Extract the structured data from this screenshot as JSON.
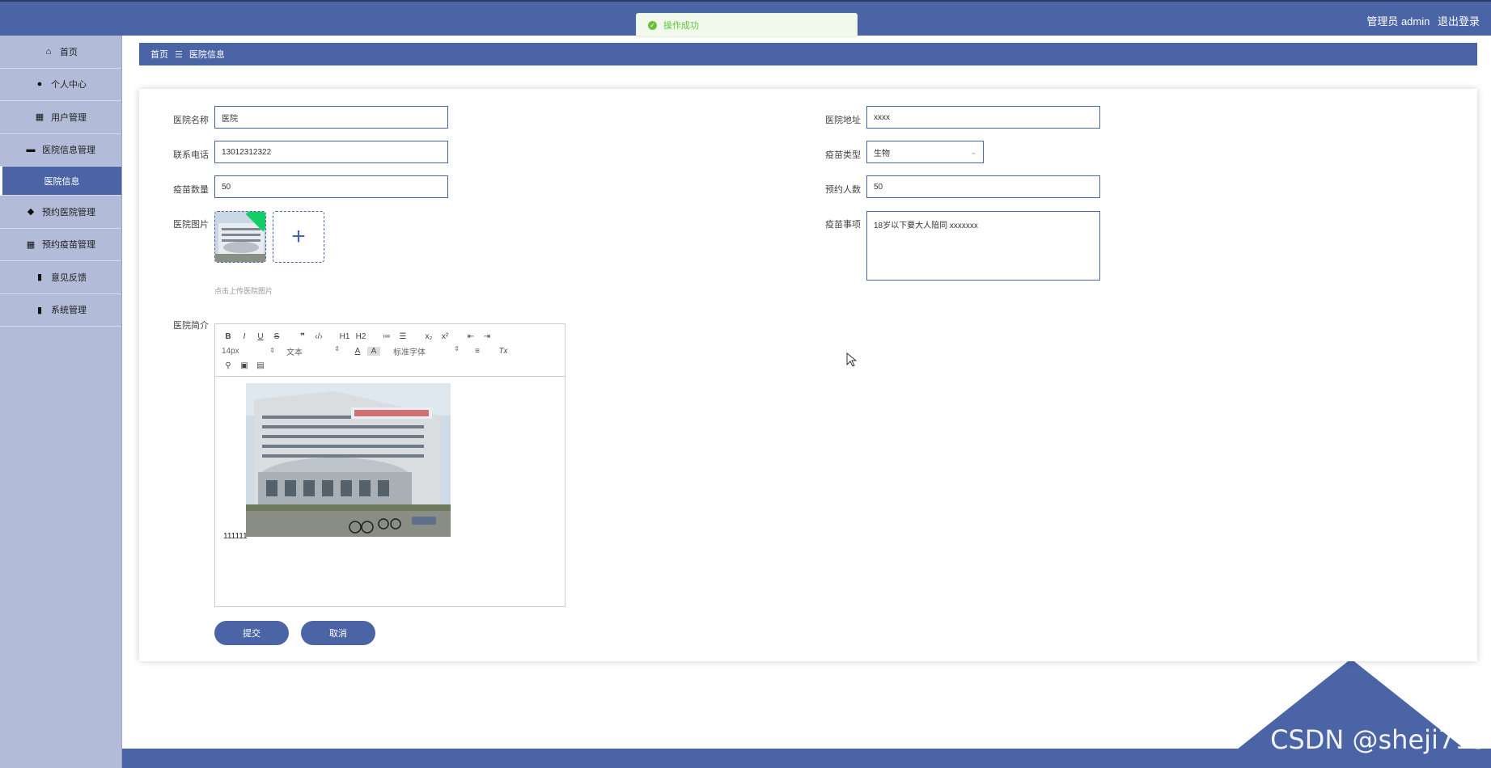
{
  "header": {
    "user_label": "管理员 admin",
    "logout_label": "退出登录"
  },
  "toast": {
    "message": "操作成功"
  },
  "sidebar": {
    "items": [
      {
        "label": "首页",
        "icon": "home-icon"
      },
      {
        "label": "个人中心",
        "icon": "user-icon"
      },
      {
        "label": "用户管理",
        "icon": "grid-icon"
      },
      {
        "label": "医院信息管理",
        "icon": "briefcase-icon"
      },
      {
        "label": "医院信息",
        "icon": "",
        "sub": true
      },
      {
        "label": "预约医院管理",
        "icon": "location-icon"
      },
      {
        "label": "预约疫苗管理",
        "icon": "grid-icon"
      },
      {
        "label": "意见反馈",
        "icon": "clipboard-icon"
      },
      {
        "label": "系统管理",
        "icon": "bar-chart-icon"
      }
    ]
  },
  "breadcrumb": {
    "home": "首页",
    "separator": "☰",
    "current": "医院信息"
  },
  "form": {
    "hospital_name": {
      "label": "医院名称",
      "value": "医院"
    },
    "hospital_address": {
      "label": "医院地址",
      "value": "xxxx"
    },
    "phone": {
      "label": "联系电话",
      "value": "13012312322"
    },
    "vaccine_type": {
      "label": "疫苗类型",
      "value": "生物"
    },
    "vaccine_count": {
      "label": "疫苗数量",
      "value": "50"
    },
    "booking_count": {
      "label": "预约人数",
      "value": "50"
    },
    "hospital_image": {
      "label": "医院图片",
      "hint": "点击上传医院图片"
    },
    "vaccine_notes": {
      "label": "疫苗事项",
      "value": "18岁以下要大人陪同 xxxxxxx"
    },
    "intro": {
      "label": "医院简介",
      "body_text": "111111",
      "toolbar": {
        "font_size": "14px",
        "block_format": "文本",
        "font_family": "标准字体",
        "h1": "H1",
        "h2": "H2",
        "sub": "x₂",
        "sup": "x²",
        "quote": "❞",
        "code": "‹/›"
      }
    },
    "submit_label": "提交",
    "cancel_label": "取消"
  },
  "watermark": "CSDN @sheji715",
  "colors": {
    "primary": "#4a64a6",
    "sidebar_bg": "#b2bbd7",
    "success": "#67c23a",
    "badge_green": "#13ce66"
  }
}
